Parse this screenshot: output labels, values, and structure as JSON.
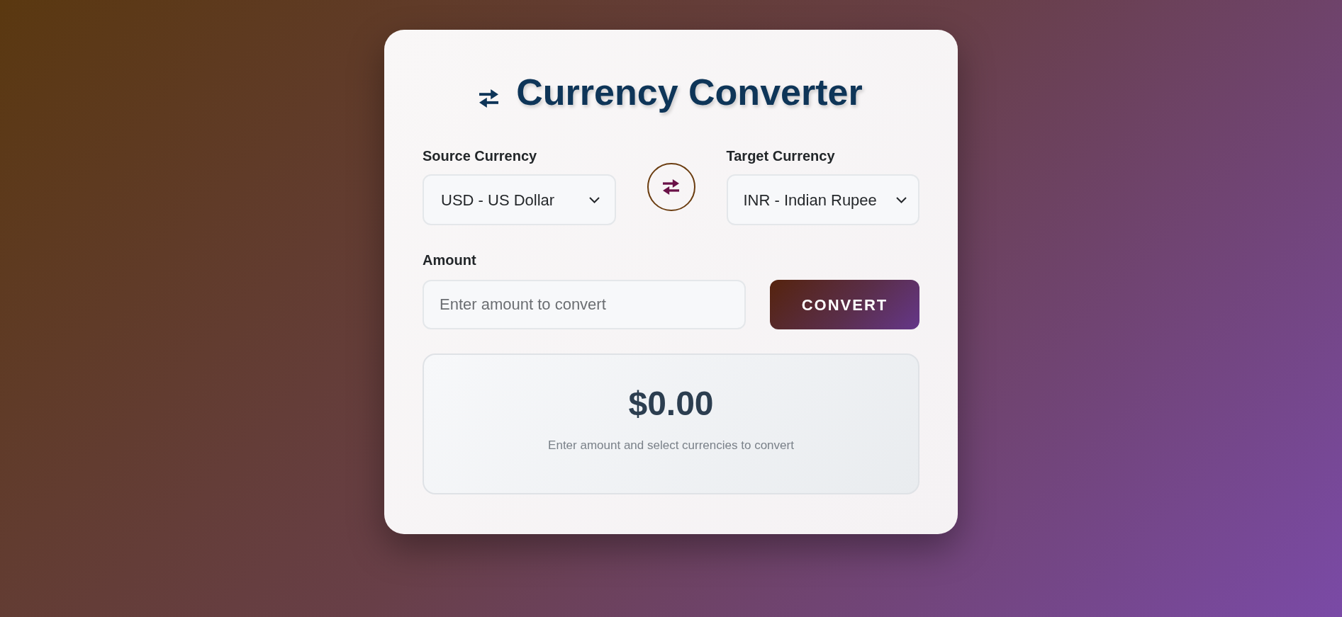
{
  "title": "Currency Converter",
  "source": {
    "label": "Source Currency",
    "value": "USD - US Dollar"
  },
  "target": {
    "label": "Target Currency",
    "value": "INR - Indian Rupee"
  },
  "amount": {
    "label": "Amount",
    "placeholder": "Enter amount to convert"
  },
  "convert_button": "CONVERT",
  "result": {
    "amount": "$0.00",
    "message": "Enter amount and select currencies to convert"
  }
}
